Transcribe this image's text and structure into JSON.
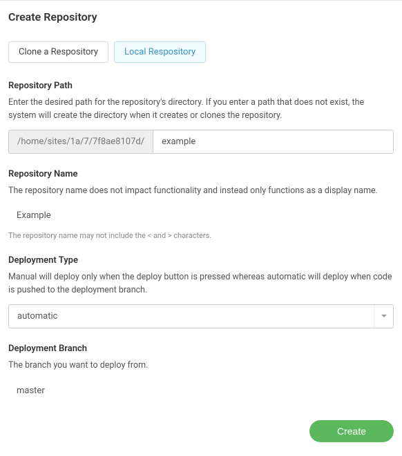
{
  "title": "Create Repository",
  "tabs": {
    "clone": "Clone a Respository",
    "local": "Local Respository"
  },
  "path": {
    "label": "Repository Path",
    "desc": "Enter the desired path for the repository's directory. If you enter a path that does not exist, the system will create the directory when it creates or clones the repository.",
    "prefix": "/home/sites/1a/7/7f8ae8107d/",
    "value": "example"
  },
  "name": {
    "label": "Repository Name",
    "desc": "The repository name does not impact functionality and instead only functions as a display name.",
    "value": "Example",
    "hint": "The repository name may not include the < and > characters."
  },
  "deploy_type": {
    "label": "Deployment Type",
    "desc": "Manual will deploy only when the deploy button is pressed whereas automatic will deploy when code is pushed to the deployment branch.",
    "value": "automatic"
  },
  "branch": {
    "label": "Deployment Branch",
    "desc": "The branch you want to deploy from.",
    "value": "master"
  },
  "actions": {
    "create": "Create"
  }
}
